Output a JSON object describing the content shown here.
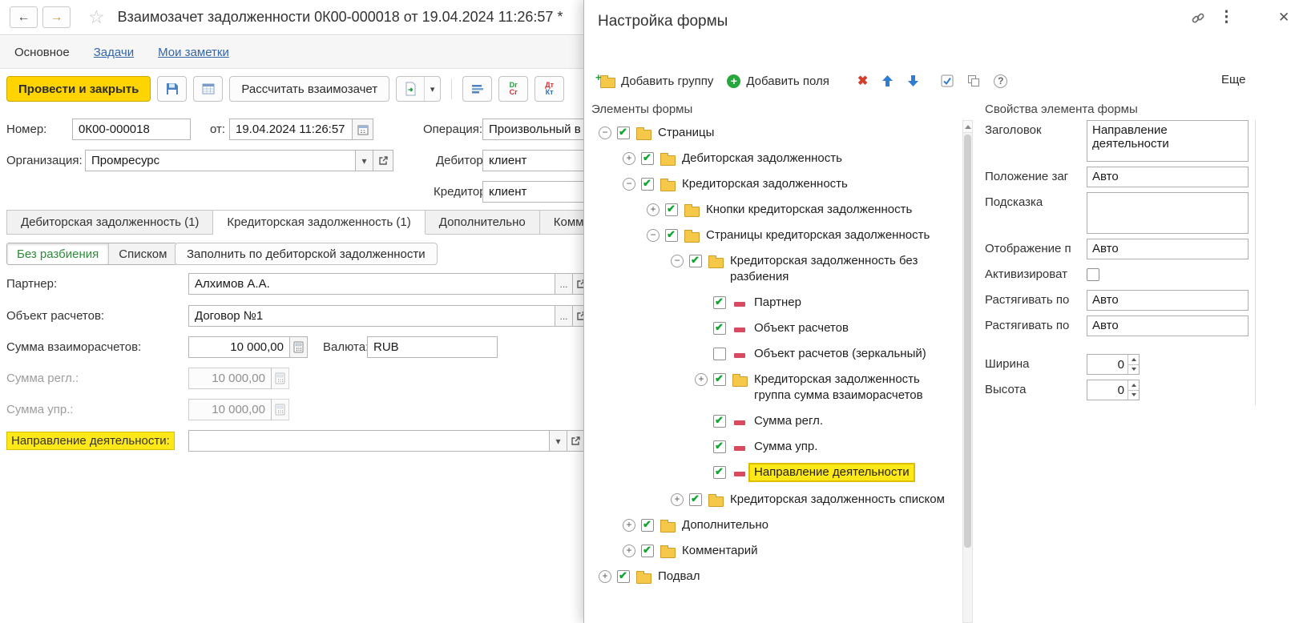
{
  "icons": {
    "back": "←",
    "forward": "→",
    "favorite": "☆",
    "menu": "⋮",
    "close": "✕",
    "dropdown": "▾",
    "dots": "...",
    "help": "?",
    "cross": "✖",
    "plus": "+",
    "minus": "−",
    "more_dd": "▾"
  },
  "main": {
    "title": "Взаимозачет задолженности 0К00-000018 от 19.04.2024 11:26:57 *",
    "nav": [
      "Основное",
      "Задачи",
      "Мои заметки"
    ],
    "commands": {
      "post_close": "Провести и закрыть",
      "calculate": "Рассчитать взаимозачет",
      "drcr": [
        "Dr",
        "Cr"
      ],
      "dtkt": [
        "Дт",
        "Кт"
      ]
    },
    "header_fields": {
      "number_label": "Номер:",
      "number": "0К00-000018",
      "date_label": "от:",
      "date": "19.04.2024 11:26:57",
      "operation_label": "Операция:",
      "operation": "Произвольный в",
      "org_label": "Организация:",
      "org": "Промресурс",
      "debtor_label": "Дебитор:",
      "debtor": "клиент",
      "creditor_label": "Кредитор:",
      "creditor": "клиент"
    },
    "tabs": [
      "Дебиторская задолженность (1)",
      "Кредиторская задолженность (1)",
      "Дополнительно",
      "Комм"
    ],
    "segments": [
      "Без разбиения",
      "Списком"
    ],
    "fill_button": "Заполнить по дебиторской задолженности",
    "fields": {
      "partner_label": "Партнер:",
      "partner": "Алхимов А.А.",
      "object_label": "Объект расчетов:",
      "object": "Договор №1",
      "amount_label": "Сумма взаиморасчетов:",
      "amount": "10 000,00",
      "currency_label": "Валюта:",
      "currency": "RUB",
      "amount_reg_label": "Сумма регл.:",
      "amount_reg": "10 000,00",
      "amount_mgmt_label": "Сумма упр.:",
      "amount_mgmt": "10 000,00",
      "direction_label": "Направление деятельности:",
      "direction": ""
    }
  },
  "dialog": {
    "title": "Настройка формы",
    "toolbar": {
      "add_group": "Добавить группу",
      "add_fields": "Добавить поля",
      "more": "Еще"
    },
    "tree_header": "Элементы формы",
    "props_header": "Свойства элемента формы",
    "tree": [
      {
        "label": "Страницы",
        "icon": "folder",
        "checked": true,
        "expand": "minus",
        "level": 0
      },
      {
        "label": "Дебиторская задолженность",
        "icon": "folder",
        "checked": true,
        "expand": "plus",
        "level": 1
      },
      {
        "label": "Кредиторская задолженность",
        "icon": "folder",
        "checked": true,
        "expand": "minus",
        "level": 1
      },
      {
        "label": "Кнопки кредиторская задолженность",
        "icon": "folder",
        "checked": true,
        "expand": "plus",
        "level": 2
      },
      {
        "label": "Страницы кредиторская задолженность",
        "icon": "folder",
        "checked": true,
        "expand": "minus",
        "level": 2
      },
      {
        "label": "Кредиторская задолженность без разбиения",
        "icon": "folder",
        "checked": true,
        "expand": "minus",
        "level": 3
      },
      {
        "label": "Партнер",
        "icon": "field",
        "checked": true,
        "expand": "none",
        "level": 4
      },
      {
        "label": "Объект расчетов",
        "icon": "field",
        "checked": true,
        "expand": "none",
        "level": 4
      },
      {
        "label": "Объект расчетов (зеркальный)",
        "icon": "field",
        "checked": false,
        "expand": "none",
        "level": 4
      },
      {
        "label": "Кредиторская задолженность группа сумма взаиморасчетов",
        "icon": "folder",
        "checked": true,
        "expand": "plus",
        "level": 4
      },
      {
        "label": "Сумма регл.",
        "icon": "field",
        "checked": true,
        "expand": "none",
        "level": 4
      },
      {
        "label": "Сумма упр.",
        "icon": "field",
        "checked": true,
        "expand": "none",
        "level": 4
      },
      {
        "label": "Направление деятельности",
        "icon": "field",
        "checked": true,
        "expand": "none",
        "level": 4,
        "highlight": true
      },
      {
        "label": "Кредиторская задолженность списком",
        "icon": "folder",
        "checked": true,
        "expand": "plus",
        "level": 3
      },
      {
        "label": "Дополнительно",
        "icon": "folder",
        "checked": true,
        "expand": "plus",
        "level": 1
      },
      {
        "label": "Комментарий",
        "icon": "folder",
        "checked": true,
        "expand": "plus",
        "level": 1
      },
      {
        "label": "Подвал",
        "icon": "folder",
        "checked": true,
        "expand": "plus",
        "level": 0
      }
    ],
    "props": [
      {
        "name": "title",
        "label": "Заголовок",
        "type": "textarea",
        "value": "Направление деятельности"
      },
      {
        "name": "title-position",
        "label": "Положение заг",
        "type": "select",
        "value": "Авто"
      },
      {
        "name": "tooltip",
        "label": "Подсказка",
        "type": "textarea",
        "value": ""
      },
      {
        "name": "tooltip-display",
        "label": "Отображение п",
        "type": "select",
        "value": "Авто"
      },
      {
        "name": "activate",
        "label": "Активизироват",
        "type": "checkbox",
        "checked": false
      },
      {
        "name": "stretch-h",
        "label": "Растягивать по",
        "type": "select",
        "value": "Авто"
      },
      {
        "name": "stretch-v",
        "label": "Растягивать по",
        "type": "select",
        "value": "Авто"
      },
      {
        "name": "width",
        "label": "Ширина",
        "type": "spinner",
        "value": "0",
        "gap": true
      },
      {
        "name": "height",
        "label": "Высота",
        "type": "spinner",
        "value": "0"
      }
    ]
  },
  "colors": {
    "accent_yellow": "#ffd400",
    "highlight_yellow": "#ffe817",
    "link_blue": "#3567a8",
    "check_green": "#13a533",
    "folder_yellow": "#f6c84a",
    "field_red": "#d84a5f"
  }
}
